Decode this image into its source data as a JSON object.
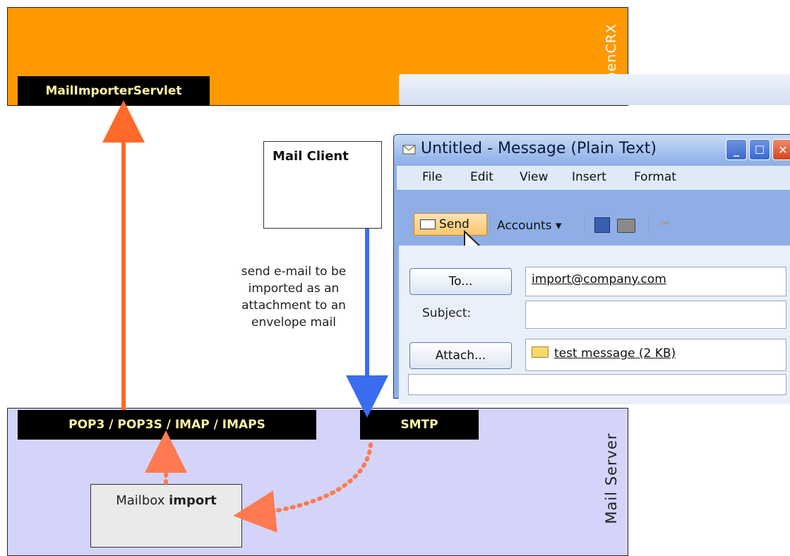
{
  "opencrx": {
    "label": "openCRX",
    "servlet_label": "MailImporterServlet"
  },
  "mail_server": {
    "label": "Mail Server",
    "protocols_label": "POP3 / POP3S / IMAP / IMAPS",
    "smtp_label": "SMTP",
    "mailbox_prefix": "Mailbox ",
    "mailbox_name": "import"
  },
  "mail_client": {
    "label": "Mail Client"
  },
  "send_note": [
    "send e-mail to be",
    "imported as an",
    "attachment to an",
    "envelope mail"
  ],
  "outlook": {
    "title": "Untitled - Message (Plain Text)",
    "menu": [
      "File",
      "Edit",
      "View",
      "Insert",
      "Format"
    ],
    "toolbar": {
      "send_label": "Send",
      "accounts_label": "Accounts ▾",
      "cut_glyph": "✂"
    },
    "to_button": "To...",
    "to_value": "import@company.com",
    "subject_label": "Subject:",
    "attach_button": "Attach...",
    "attachment": "test message (2 KB)"
  },
  "colors": {
    "crx": "#ff9900",
    "server": "#d4d4fa",
    "arrow_orange": "#ff6a2a",
    "arrow_blue": "#3a6cf0",
    "dotted": "#ff7a50"
  }
}
